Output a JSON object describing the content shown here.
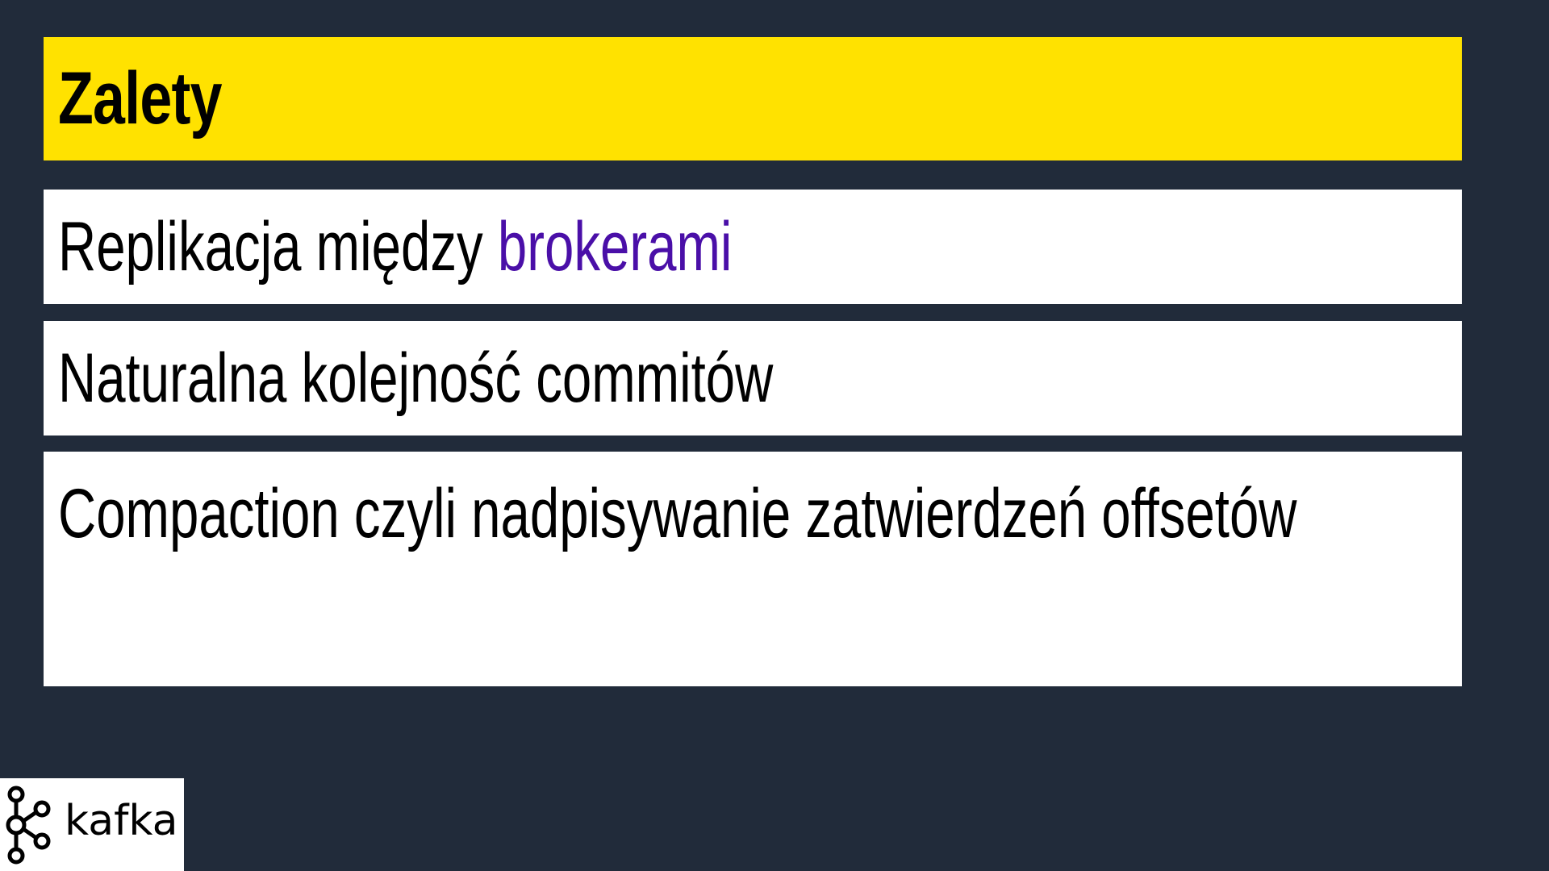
{
  "slide": {
    "title": "Zalety",
    "items": [
      {
        "text_main": "Replikacja między ",
        "text_accent": "brokerami"
      },
      {
        "text_main": "Naturalna kolejność commitów"
      },
      {
        "text_main": "Compaction czyli nadpisywanie zatwierdzeń offsetów"
      }
    ]
  },
  "logo": {
    "text": "kafka",
    "icon": "kafka-logo-icon"
  },
  "colors": {
    "background": "#212b3a",
    "title_bar": "#ffe200",
    "accent": "#4a0fa8",
    "item_bg": "#ffffff"
  }
}
